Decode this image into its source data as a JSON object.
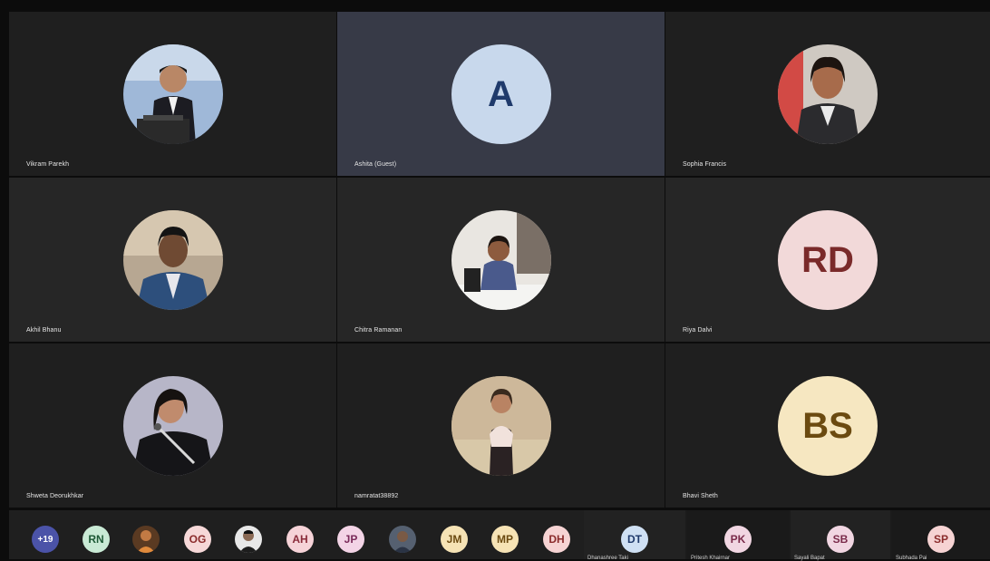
{
  "participants": [
    {
      "name": "Vikram Parekh",
      "avatar": "photo-man-suit-podium-icon"
    },
    {
      "name": "Ashita (Guest)",
      "initials": "A",
      "active": true,
      "bg": "#c8d8ec",
      "fg": "#1f3a6b"
    },
    {
      "name": "Sophia Francis",
      "avatar": "photo-woman-blazer-icon"
    },
    {
      "name": "Akhil  Bhanu",
      "avatar": "photo-man-blue-suit-icon"
    },
    {
      "name": "Chitra Ramanan",
      "avatar": "photo-woman-desk-icon"
    },
    {
      "name": "Riya Dalvi",
      "initials": "RD",
      "bg": "#f2d9d9",
      "fg": "#7a2a2a"
    },
    {
      "name": "Shweta Deorukhkar",
      "avatar": "photo-woman-microphone-icon"
    },
    {
      "name": "namratat38892",
      "avatar": "photo-woman-standing-icon"
    },
    {
      "name": "Bhavi Sheth",
      "initials": "BS",
      "bg": "#f6e7c1",
      "fg": "#6b4a10"
    }
  ],
  "overflow": {
    "more_count": "+19",
    "chips": [
      {
        "label": "RN",
        "bg": "#c9ead5",
        "fg": "#1e5a36"
      },
      {
        "label": "",
        "photo": "photo-person-orange-icon"
      },
      {
        "label": "OG",
        "bg": "#f6d8d8",
        "fg": "#8a2b2b"
      },
      {
        "label": "",
        "photo": "photo-man-glasses-icon"
      },
      {
        "label": "AH",
        "bg": "#f6d3d8",
        "fg": "#8a2b3a"
      },
      {
        "label": "JP",
        "bg": "#f3d4e6",
        "fg": "#7a2a5a"
      },
      {
        "label": "",
        "photo": "photo-man-dark-icon"
      },
      {
        "label": "JM",
        "bg": "#f6e3b5",
        "fg": "#6b4a10"
      },
      {
        "label": "MP",
        "bg": "#f6e3b5",
        "fg": "#6b4a10"
      },
      {
        "label": "DH",
        "bg": "#f6d3d3",
        "fg": "#8a2b2b"
      }
    ],
    "tiles": [
      {
        "initials": "DT",
        "name": "Dhanashree Taki",
        "bg": "#cfe0f3",
        "fg": "#1f3a6b"
      },
      {
        "initials": "PK",
        "name": "Pritesh Khairnar",
        "bg": "#f1d6e2",
        "fg": "#7a2a4a"
      },
      {
        "initials": "SB",
        "name": "Sayali Bapat",
        "bg": "#f1d6e2",
        "fg": "#7a2a4a"
      },
      {
        "initials": "SP",
        "name": "Subhada Pai",
        "bg": "#f6d3d3",
        "fg": "#8a2b2b"
      }
    ]
  }
}
